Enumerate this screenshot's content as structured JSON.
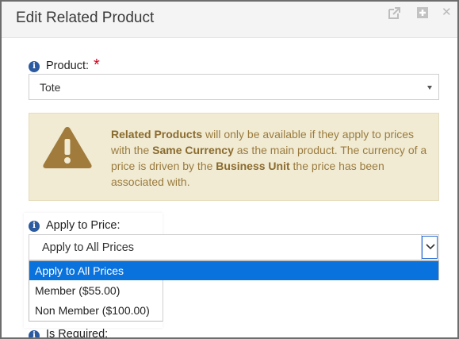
{
  "dialog": {
    "title": "Edit Related Product",
    "header_icons": [
      "popout-icon",
      "add-icon",
      "close-icon"
    ],
    "close_glyph": "✕"
  },
  "product": {
    "label": "Product:",
    "required_mark": "*",
    "value": "Tote"
  },
  "alert": {
    "parts": {
      "b1": "Related Products",
      "t1": " will only be available if they apply to prices with the ",
      "b2": "Same Currency",
      "t2": " as the main product. The currency of a price is driven by the ",
      "b3": "Business Unit",
      "t3": " the price has been associated with."
    },
    "icon": "warning-icon"
  },
  "apply_to_price": {
    "label": "Apply to Price:",
    "value": "Apply to All Prices",
    "options": [
      "Apply to All Prices",
      "Member ($55.00)",
      "Non Member ($100.00)"
    ],
    "selected_index": 0
  },
  "is_required": {
    "label": "Is Required:"
  },
  "colors": {
    "accent": "#0a72dc",
    "info": "#2c5aa0",
    "alert_bg": "#f1ebd4",
    "alert_text": "#9a7b3e",
    "required": "#d0021b"
  }
}
